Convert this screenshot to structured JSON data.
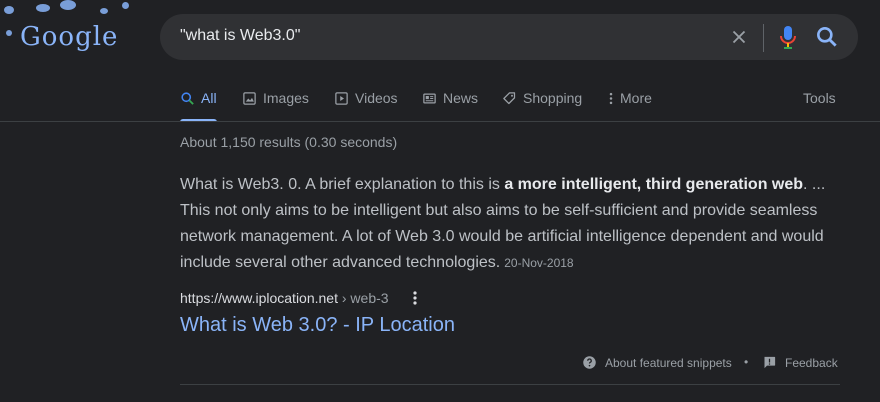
{
  "logo": {
    "text": "Google"
  },
  "search": {
    "query": "\"what is Web3.0\""
  },
  "tabs": [
    {
      "label": "All",
      "icon": "search-icon"
    },
    {
      "label": "Images",
      "icon": "image-icon"
    },
    {
      "label": "Videos",
      "icon": "video-icon"
    },
    {
      "label": "News",
      "icon": "news-icon"
    },
    {
      "label": "Shopping",
      "icon": "tag-icon"
    },
    {
      "label": "More",
      "icon": "more-vert-icon"
    }
  ],
  "tools_label": "Tools",
  "result_stats": "About 1,150 results (0.30 seconds)",
  "snippet": {
    "part1": "What is Web3. 0. A brief explanation to this is ",
    "bold": "a more intelligent, third generation web",
    "part2": ". ... This not only aims to be intelligent but also aims to be self-sufficient and provide seamless network management. A lot of Web 3.0 would be artificial intelligence dependent and would include several other advanced technologies.",
    "date": "20-Nov-2018"
  },
  "result": {
    "url": "https://www.iplocation.net",
    "breadcrumb": " › web-3",
    "title": "What is Web 3.0? - IP Location"
  },
  "footer": {
    "about_label": "About featured snippets",
    "separator": "•",
    "feedback_label": "Feedback"
  },
  "colors": {
    "background": "#202124",
    "accent": "#8ab4f8",
    "text": "#bdc1c6",
    "muted": "#9aa0a6"
  }
}
